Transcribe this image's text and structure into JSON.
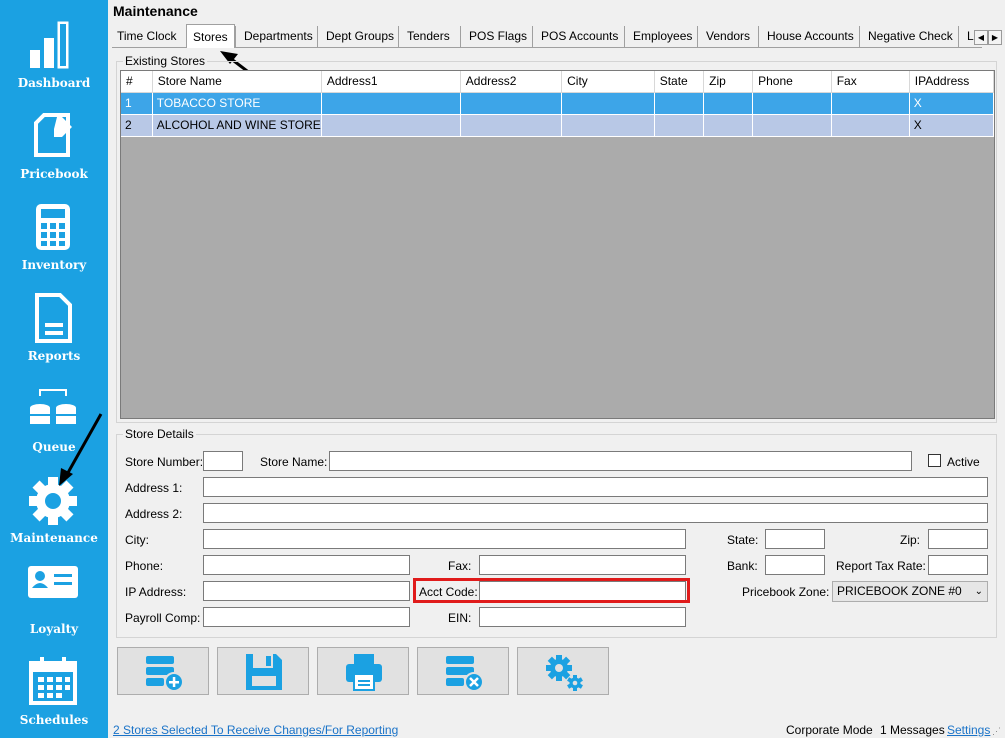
{
  "sidebar": {
    "items": [
      {
        "label": "Dashboard",
        "icon": "bar-chart-icon"
      },
      {
        "label": "Pricebook",
        "icon": "edit-document-icon"
      },
      {
        "label": "Inventory",
        "icon": "calculator-icon"
      },
      {
        "label": "Reports",
        "icon": "document-icon"
      },
      {
        "label": "Queue",
        "icon": "database-sync-icon"
      },
      {
        "label": "Maintenance",
        "icon": "gear-icon"
      },
      {
        "label": "Loyalty",
        "icon": "id-card-icon"
      },
      {
        "label": "Schedules",
        "icon": "calendar-icon"
      }
    ]
  },
  "header": {
    "title": "Maintenance"
  },
  "tabs": [
    "Time Clock",
    "Stores",
    "Departments",
    "Dept Groups",
    "Tenders",
    "POS Flags",
    "POS Accounts",
    "Employees",
    "Vendors",
    "House Accounts",
    "Negative Check",
    "L"
  ],
  "active_tab": "Stores",
  "existing_stores": {
    "label": "Existing Stores",
    "columns": [
      "#",
      "Store Name",
      "Address1",
      "Address2",
      "City",
      "State",
      "Zip",
      "Phone",
      "Fax",
      "IPAddress"
    ],
    "rows": [
      [
        "1",
        "TOBACCO STORE",
        "",
        "",
        "",
        "",
        "",
        "",
        "",
        "X"
      ],
      [
        "2",
        "ALCOHOL AND WINE STORE",
        "",
        "",
        "",
        "",
        "",
        "",
        "",
        "X"
      ]
    ]
  },
  "store_details": {
    "label": "Store Details",
    "store_number": "Store Number:",
    "store_name": "Store Name:",
    "active": "Active",
    "address1": "Address 1:",
    "address2": "Address 2:",
    "city": "City:",
    "state": "State:",
    "zip": "Zip:",
    "phone": "Phone:",
    "fax": "Fax:",
    "bank": "Bank:",
    "report_tax_rate": "Report Tax Rate:",
    "ip_address": "IP Address:",
    "acct_code": "Acct Code:",
    "pricebook_zone": "Pricebook Zone:",
    "pricebook_zone_value": "PRICEBOOK ZONE #0",
    "payroll_comp": "Payroll Comp:",
    "ein": "EIN:"
  },
  "status": {
    "selected": "2 Stores Selected To Receive Changes/For Reporting",
    "mode": "Corporate Mode",
    "messages": "1 Messages",
    "settings": "Settings"
  },
  "colors": {
    "sidebar": "#1ba1e2",
    "selected_row": "#3da5e8",
    "alt_row": "#b8c8e6",
    "highlight": "#e01b1b"
  }
}
